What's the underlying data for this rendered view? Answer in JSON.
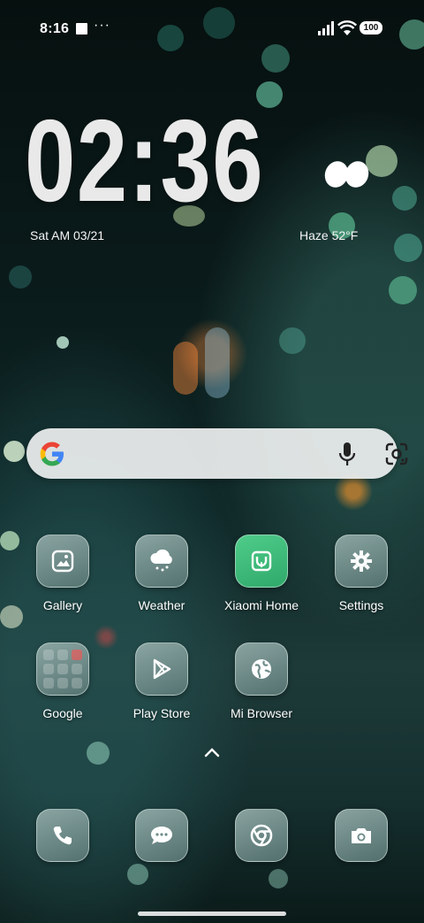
{
  "status_bar": {
    "time": "8:16",
    "more": "···",
    "battery": "100"
  },
  "clock_widget": {
    "time": "02:36",
    "date": "Sat AM 03/21",
    "weather": "Haze  52°F"
  },
  "search_bar": {
    "logo": "google-logo-icon",
    "mic": "mic-icon",
    "lens": "lens-icon"
  },
  "apps_row1": [
    {
      "label": "Gallery",
      "icon": "image-icon"
    },
    {
      "label": "Weather",
      "icon": "cloud-icon"
    },
    {
      "label": "Xiaomi Home",
      "icon": "mi-home-icon"
    },
    {
      "label": "Settings",
      "icon": "gear-icon"
    }
  ],
  "apps_row2": [
    {
      "label": "Google",
      "icon": "folder-icon"
    },
    {
      "label": "Play Store",
      "icon": "play-icon"
    },
    {
      "label": "Mi Browser",
      "icon": "globe-icon"
    }
  ],
  "dock": [
    {
      "icon": "phone-icon"
    },
    {
      "icon": "message-icon"
    },
    {
      "icon": "chrome-icon"
    },
    {
      "icon": "camera-icon"
    }
  ]
}
